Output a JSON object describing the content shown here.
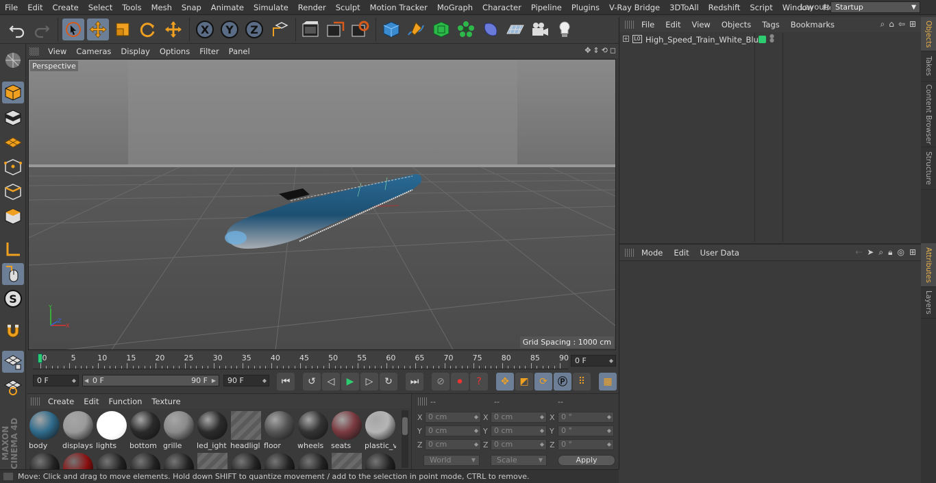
{
  "menubar": {
    "items": [
      "File",
      "Edit",
      "Create",
      "Select",
      "Tools",
      "Mesh",
      "Snap",
      "Animate",
      "Simulate",
      "Render",
      "Sculpt",
      "Motion Tracker",
      "MoGraph",
      "Character",
      "Pipeline",
      "Plugins",
      "V-Ray Bridge",
      "3DToAll",
      "Redshift",
      "Script",
      "Window",
      "Help"
    ],
    "layout_label": "Layout:",
    "layout_value": "Startup"
  },
  "toolbar": {
    "icons": [
      "undo-icon",
      "redo-icon",
      "live-selection-icon",
      "move-icon",
      "scale-icon",
      "rotate-icon",
      "move-axis-icon",
      "x-axis-icon",
      "y-axis-icon",
      "z-axis-icon",
      "coordinate-system-icon",
      "render-view-icon",
      "render-picture-viewer-icon",
      "render-settings-icon",
      "cube-icon",
      "pen-spline-icon",
      "subdivision-icon",
      "cloner-icon",
      "deformer-icon",
      "floor-icon",
      "camera-icon",
      "light-icon"
    ],
    "axis_x": "X",
    "axis_y": "Y",
    "axis_z": "Z"
  },
  "viewport": {
    "menu": [
      "View",
      "Cameras",
      "Display",
      "Options",
      "Filter",
      "Panel"
    ],
    "label": "Perspective",
    "grid_spacing": "Grid Spacing : 1000 cm",
    "axis_x": "X",
    "axis_y": "Y",
    "axis_z": "Z"
  },
  "timeline": {
    "ticks": [
      0,
      5,
      10,
      15,
      20,
      25,
      30,
      35,
      40,
      45,
      50,
      55,
      60,
      65,
      70,
      75,
      80,
      85,
      90
    ],
    "current_frame": "0 F"
  },
  "transport": {
    "start_frame": "0 F",
    "range_start": "0 F",
    "range_end": "90 F",
    "end_frame": "90 F"
  },
  "materials": {
    "menu": [
      "Create",
      "Edit",
      "Function",
      "Texture"
    ],
    "items": [
      {
        "name": "body",
        "color": "#2f6b8c"
      },
      {
        "name": "displays",
        "color": "#9a9a9a"
      },
      {
        "name": "lights",
        "color": "#ffffff"
      },
      {
        "name": "bottom",
        "color": "#2a2a2a"
      },
      {
        "name": "grille",
        "color": "#8a8a8a"
      },
      {
        "name": "led_ight",
        "color": "#2b2b2b"
      },
      {
        "name": "headligl",
        "color": "#6a6a6a"
      },
      {
        "name": "floor",
        "color": "#555555"
      },
      {
        "name": "wheels",
        "color": "#333333"
      },
      {
        "name": "seats",
        "color": "#7a3a40"
      },
      {
        "name": "plastic_v",
        "color": "#b5b5b5"
      }
    ]
  },
  "coords": {
    "headers": [
      "--",
      "--",
      "--"
    ],
    "rows": [
      {
        "axis": "X",
        "pos": "0 cm",
        "size": "0 cm",
        "rot_axis": "X",
        "rot": "0 °"
      },
      {
        "axis": "Y",
        "pos": "0 cm",
        "size": "0 cm",
        "rot_axis": "Y",
        "rot": "0 °"
      },
      {
        "axis": "Z",
        "pos": "0 cm",
        "size": "0 cm",
        "rot_axis": "Z",
        "rot": "0 °"
      }
    ],
    "mode_world": "World",
    "mode_scale": "Scale",
    "apply": "Apply"
  },
  "status": "Move: Click and drag to move elements. Hold down SHIFT to quantize movement / add to the selection in point mode, CTRL to remove.",
  "objects": {
    "menu": [
      "File",
      "Edit",
      "View",
      "Objects",
      "Tags",
      "Bookmarks"
    ],
    "items": [
      {
        "name": "High_Speed_Train_White_Blue",
        "tag_color": "#2ecc71"
      }
    ]
  },
  "attributes": {
    "menu": [
      "Mode",
      "Edit",
      "User Data"
    ]
  },
  "sidetabs": [
    "Objects",
    "Takes",
    "Content Browser",
    "Structure",
    "Attributes",
    "Layers"
  ],
  "logo": {
    "line1": "MAXON",
    "line2": "CINEMA 4D"
  }
}
